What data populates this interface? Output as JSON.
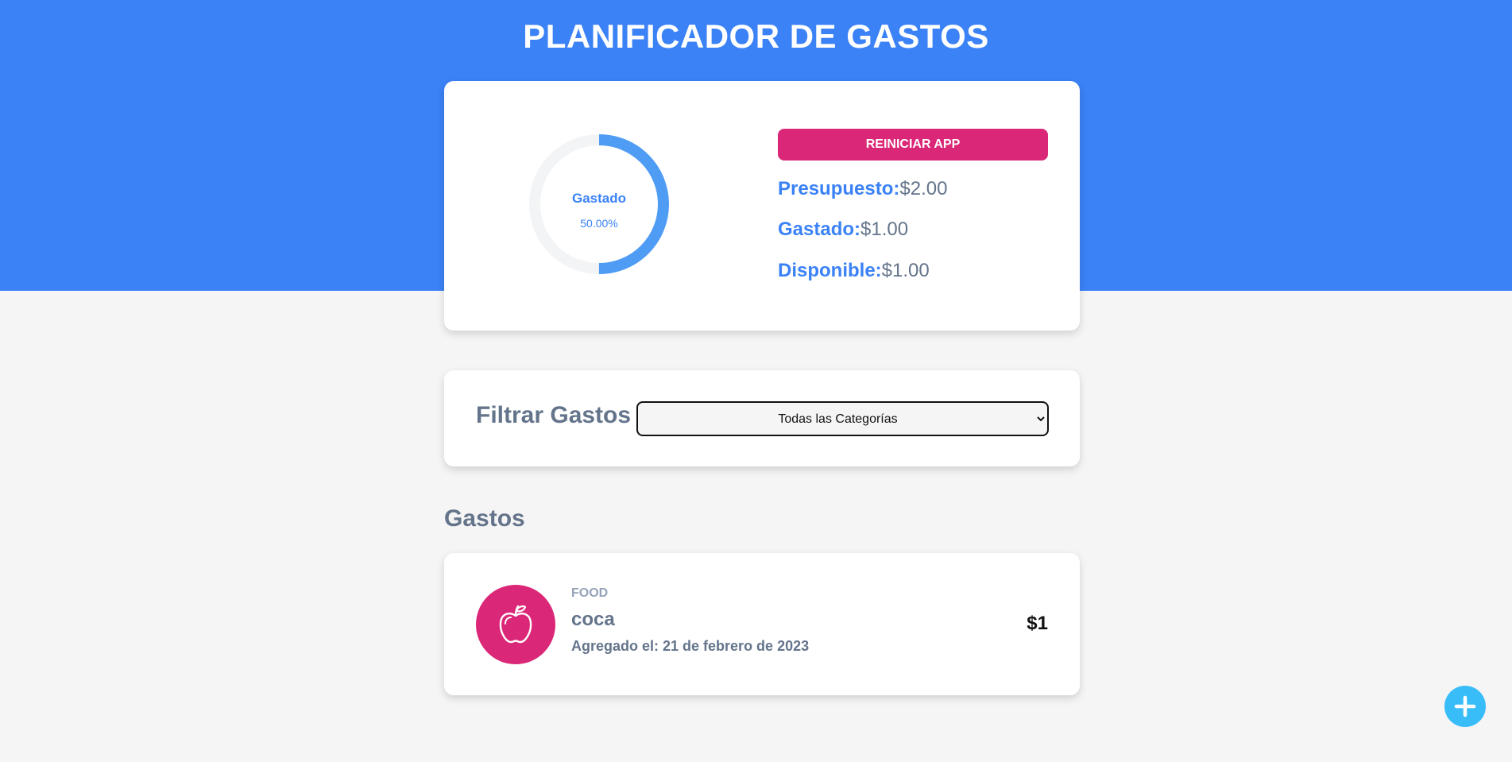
{
  "app": {
    "title": "PLANIFICADOR DE GASTOS"
  },
  "colors": {
    "header": "#3b82f6",
    "accent": "#3b82f6",
    "danger": "#db2777",
    "fab": "#38bdf8",
    "muted_text": "#64748b"
  },
  "budget": {
    "progress_label": "Gastado",
    "progress_percent_text": "50.00%",
    "progress_fraction": 0.5,
    "reset_label": "REINICIAR APP",
    "stats": [
      {
        "label": "Presupuesto:",
        "value": "$2.00"
      },
      {
        "label": "Gastado:",
        "value": "$1.00"
      },
      {
        "label": "Disponible:",
        "value": "$1.00"
      }
    ]
  },
  "filter": {
    "label": "Filtrar Gastos",
    "selected": "Todas las Categorías"
  },
  "expenses": {
    "title": "Gastos",
    "items": [
      {
        "category": "FOOD",
        "icon": "apple-icon",
        "name": "coca",
        "date": "Agregado el: 21 de febrero de 2023",
        "amount": "$1"
      }
    ]
  },
  "fab": {
    "icon": "plus-icon"
  }
}
